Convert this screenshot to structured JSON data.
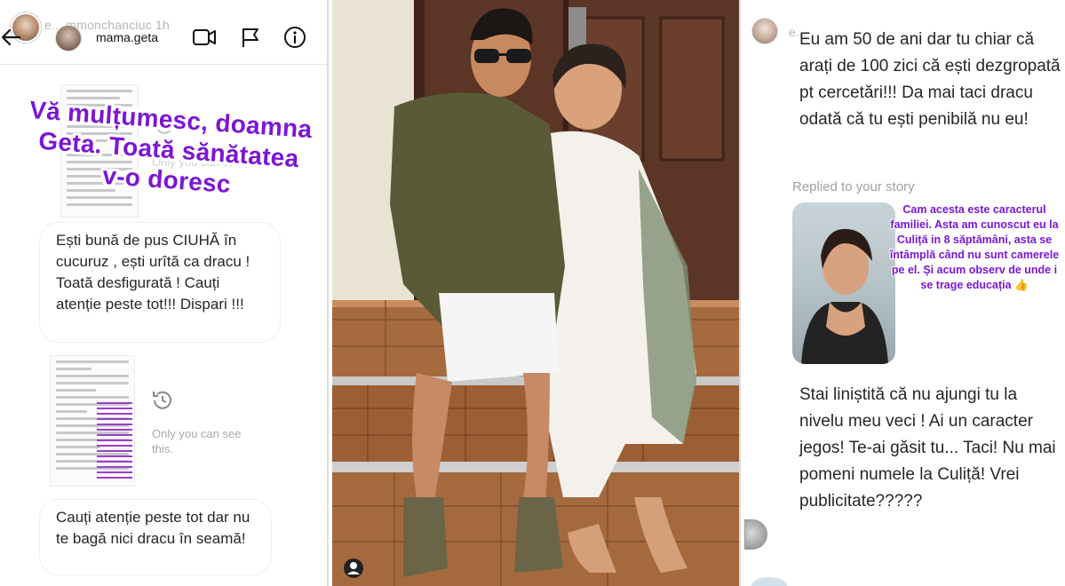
{
  "left_panel": {
    "top_username": "e... mmonchanciuc 1h",
    "thread_name": "mama.geta",
    "header_icons": [
      "back-arrow-icon",
      "video-camera-icon",
      "flag-icon",
      "info-icon"
    ],
    "sticker_lines": [
      "Vă mulțumesc, doamna",
      "Geta. Toată sănătatea",
      "v-o doresc"
    ],
    "only_you_see": "Only you can see this.",
    "bubble_1": "Ești bună de pus CIUHĂ în cucuruz , ești urîtă ca dracu ! Toată desfigurată ! Cauți atenție peste tot!!! Dispari !!!",
    "bubble_2": "Cauți atenție peste tot dar nu te bagă nici dracu în seamă!"
  },
  "photo": {
    "description_icon": "profile-icon"
  },
  "right_panel": {
    "top_username": "e...",
    "message_1": "Eu am 50 de ani dar tu chiar că arați de 100 zici că ești dezgropată pt cercetări!!! Da mai taci dracu odată că tu ești penibilă nu eu!",
    "replied_label": "Replied to your story",
    "reply_caption": "Cam acesta este caracterul familiei. Asta am cunoscut eu la Culiță in 8 săptămâni, asta se întâmplă când nu sunt camerele pe el. Și acum observ de unde i se trage educația 👍",
    "message_2": "Stai liniștită că nu ajungi tu la nivelu  meu veci ! Ai un caracter jegos!  Te-ai găsit tu... Taci! Nu mai pomeni numele  la Culiță! Vrei publicitate?????"
  },
  "colors": {
    "sticker_purple": "#7b16d6",
    "text_dark": "#262626",
    "muted_gray": "#a8a8a8"
  }
}
